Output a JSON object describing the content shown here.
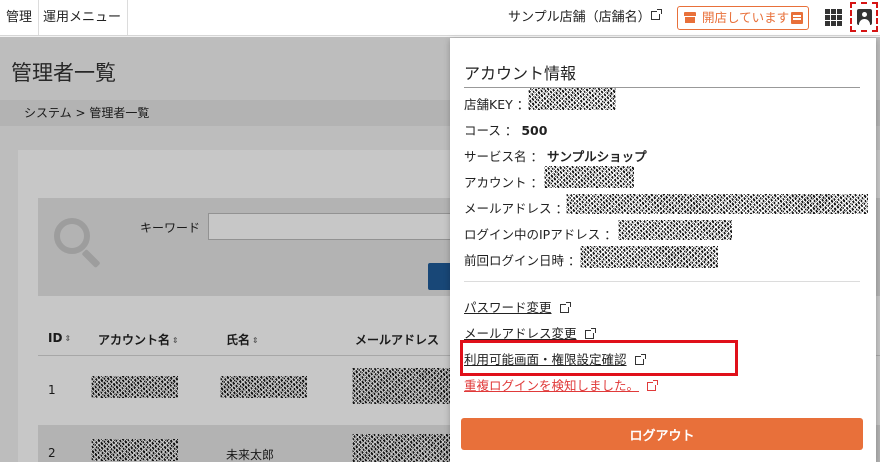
{
  "topbar": {
    "menu_items": [
      "管理",
      "運用メニュー"
    ],
    "shop_name": "サンプル店舗（店舗名）",
    "open_status": "開店しています"
  },
  "page": {
    "title": "管理者一覧",
    "breadcrumb": "システム > 管理者一覧",
    "search": {
      "keyword_label": "キーワード",
      "keyword_value": ""
    },
    "table": {
      "headers": [
        "ID",
        "アカウント名",
        "氏名",
        "メールアドレス"
      ],
      "rows": [
        {
          "id": "1",
          "name": ""
        },
        {
          "id": "2",
          "name": "未来太郎"
        }
      ]
    }
  },
  "popup": {
    "title": "アカウント情報",
    "shop_key_label": "店舗KEY ：",
    "course_label": "コース ：",
    "course_value": "500",
    "service_label": "サービス名 ：",
    "service_value": "サンプルショップ",
    "account_label": "アカウント ：",
    "email_label": "メールアドレス ：",
    "ip_label": "ログイン中のIPアドレス ：",
    "last_login_label": "前回ログイン日時 ：",
    "links": {
      "password_change": "パスワード変更",
      "email_change": "メールアドレス変更",
      "permissions": "利用可能画面・権限設定確認",
      "duplicate_login": "重複ログインを検知しました。"
    },
    "logout_label": "ログアウト"
  },
  "colors": {
    "accent": "#e8703a",
    "highlight": "#e0101a",
    "warning_link": "#e03a3a",
    "primary": "#1f5c99"
  }
}
